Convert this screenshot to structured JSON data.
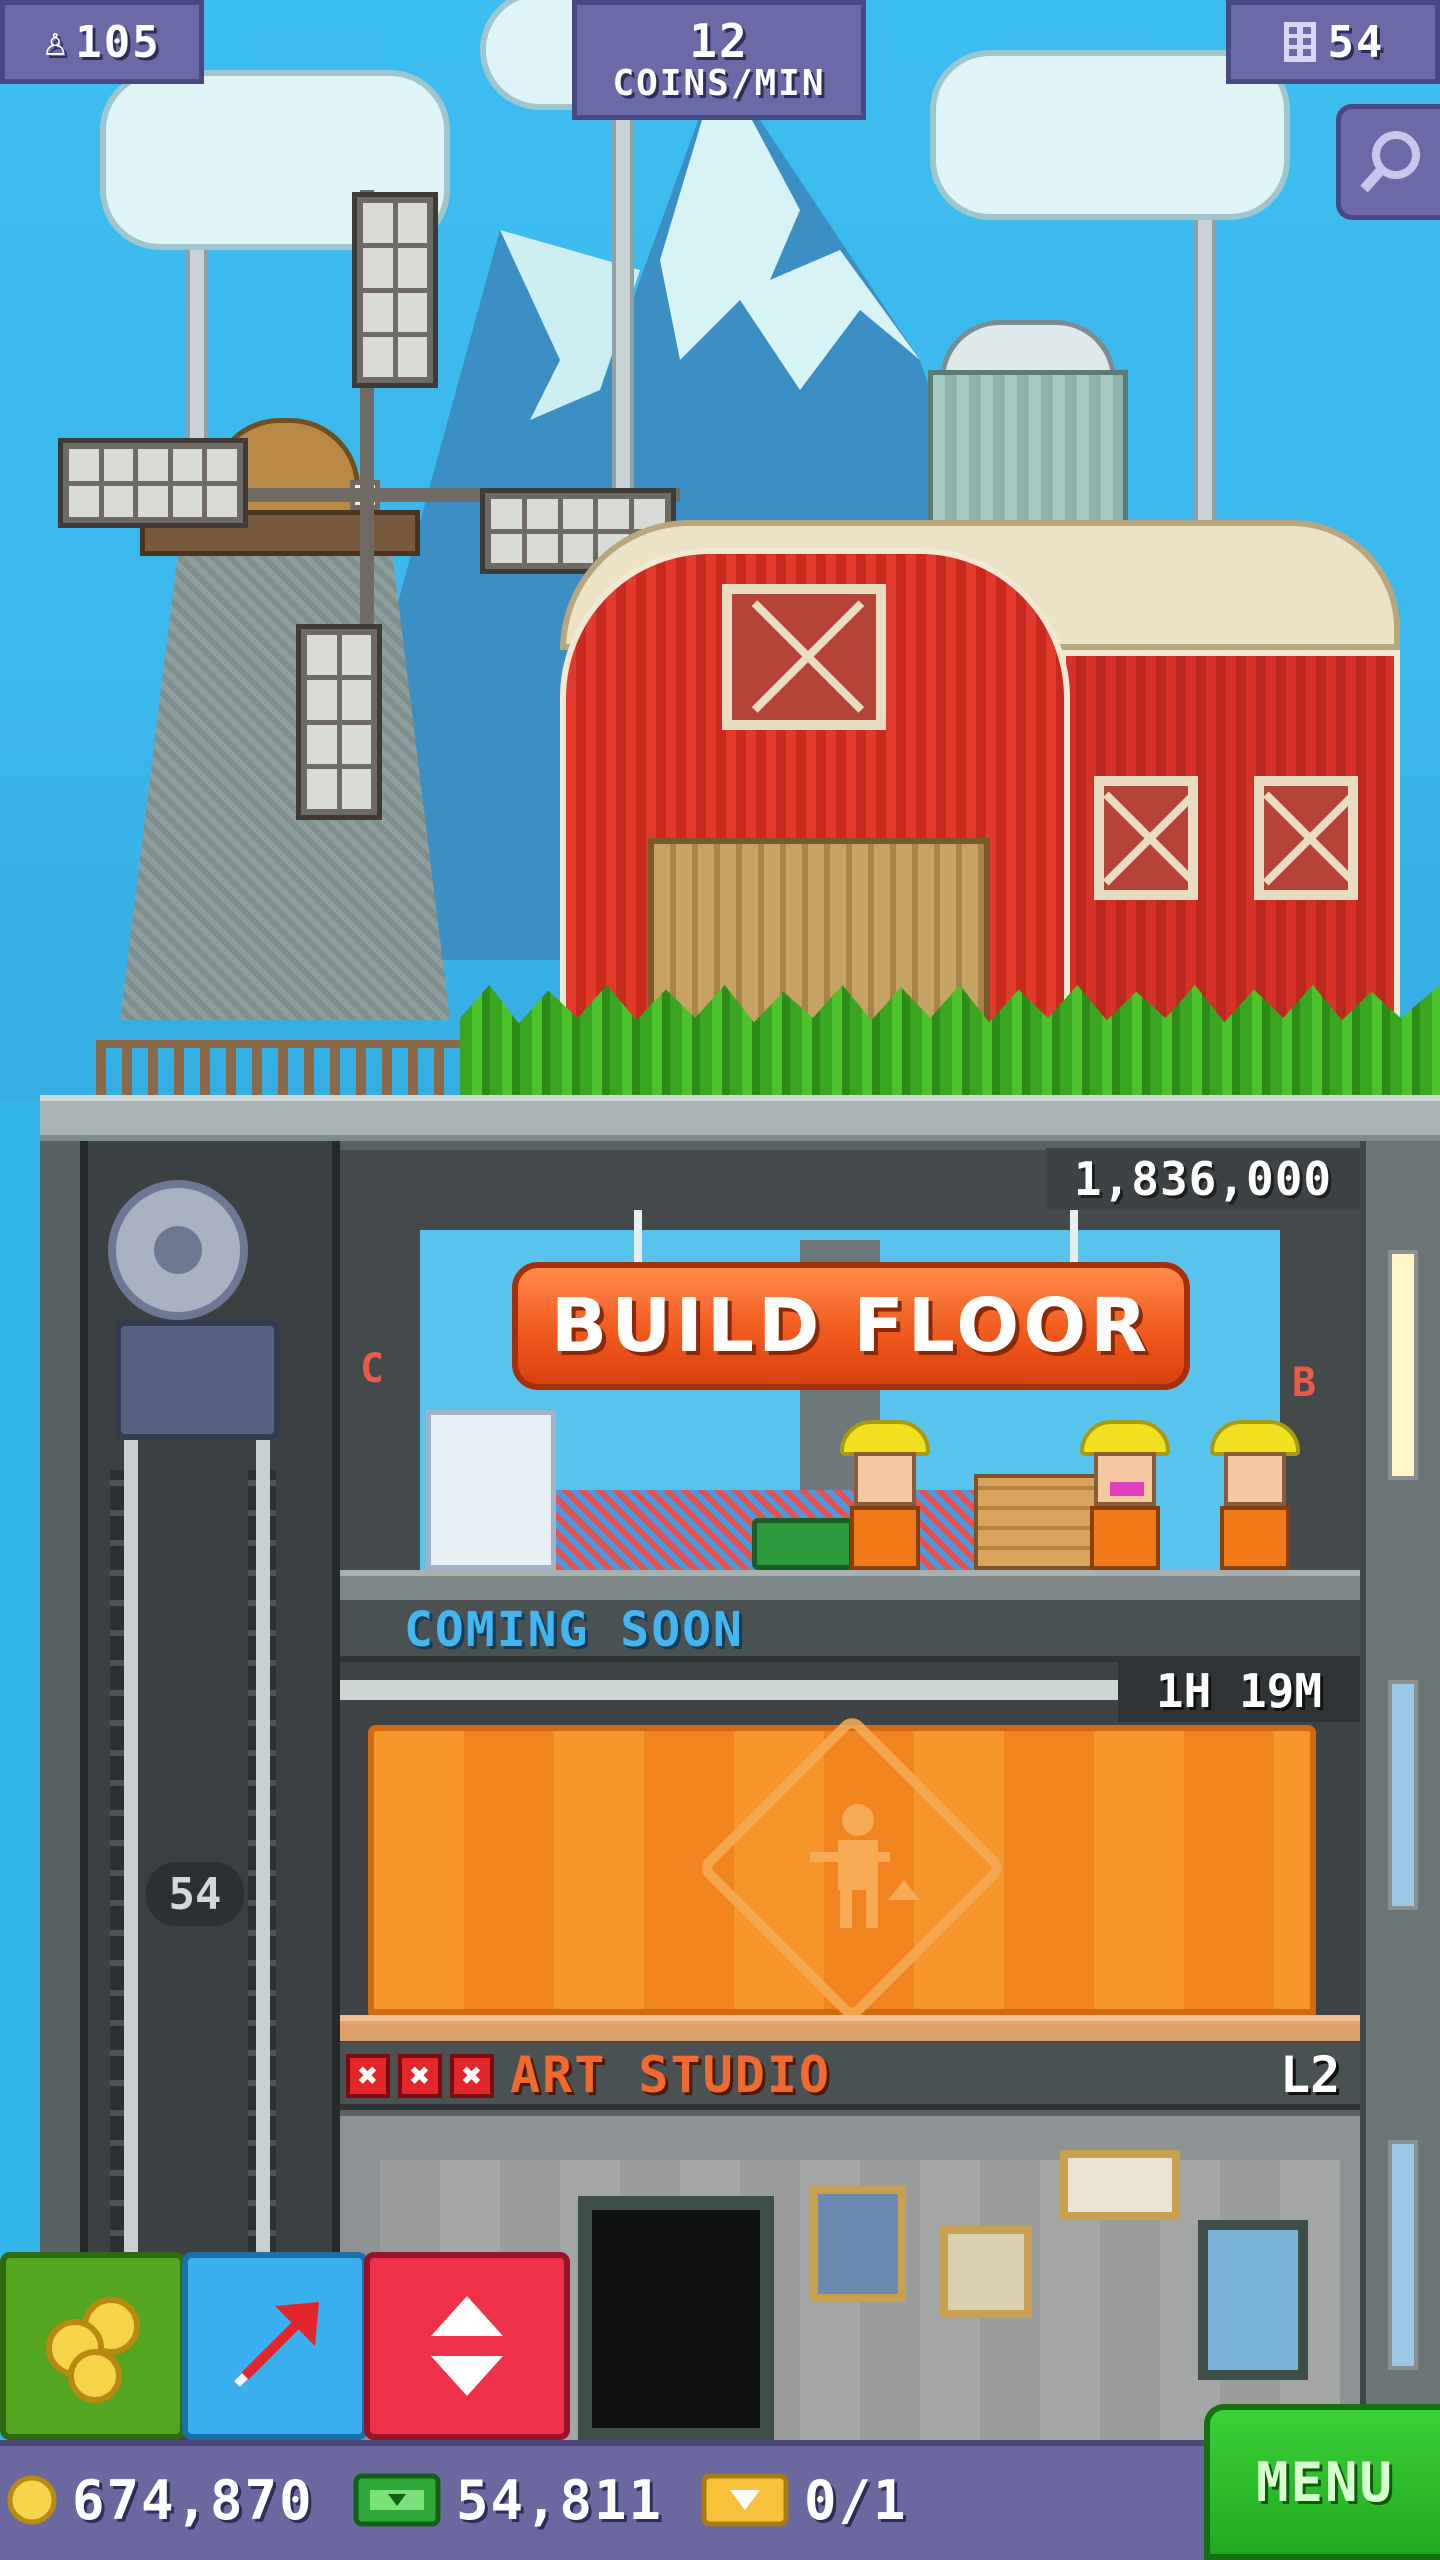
{
  "hud": {
    "population": "105",
    "population_icon": "person-icon",
    "coins_rate_value": "12",
    "coins_rate_label": "COINS/MIN",
    "floors": "54",
    "floors_icon": "building-icon",
    "zoom_icon": "magnifier-icon"
  },
  "tower": {
    "build_floor": {
      "price": "1,836,000",
      "label": "BUILD FLOOR",
      "left_tag": "C",
      "right_tag": "B"
    },
    "construction": {
      "status": "COMING SOON",
      "timer": "1H 19M"
    },
    "art_studio": {
      "name": "ART STUDIO",
      "level": "L2",
      "stock_marks": [
        "✖",
        "✖",
        "✖"
      ],
      "stock_color": "#e2262a"
    },
    "elevator_floor": "54"
  },
  "controls": {
    "coins_icon": "coins-icon",
    "goto_icon": "arrow-up-right-icon",
    "elevator_icon": "up-down-arrows-icon"
  },
  "bottom": {
    "coins": "674,870",
    "bux": "54,811",
    "tickets": "0/1",
    "menu_label": "MENU"
  },
  "colors": {
    "sky": "#35b6ea",
    "hud": "#6c6aa6",
    "build_button": "#f05a1e",
    "menu_button": "#22a820"
  }
}
